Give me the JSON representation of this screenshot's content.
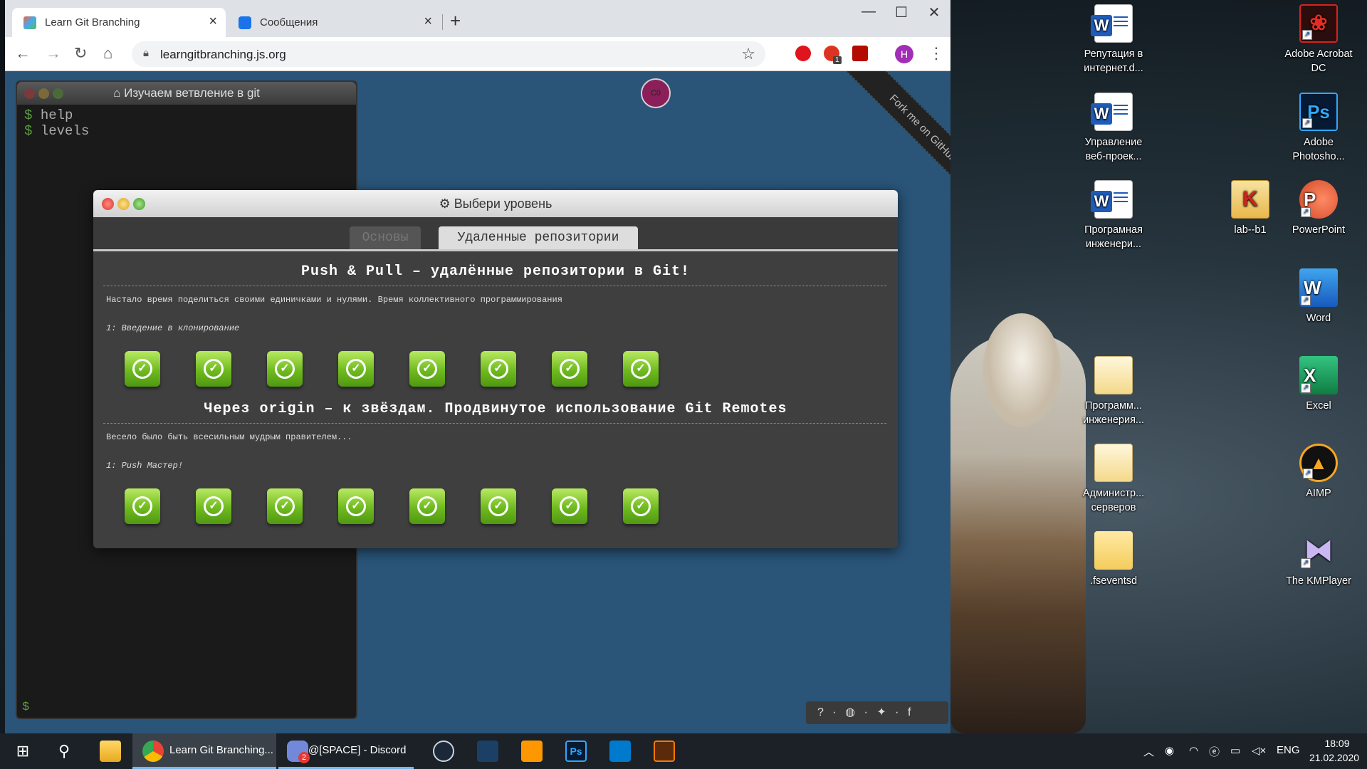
{
  "browser": {
    "tabs": [
      {
        "label": "Learn Git Branching",
        "active": true
      },
      {
        "label": "Сообщения",
        "active": false
      }
    ],
    "url": "learngitbranching.js.org",
    "profile_initial": "H",
    "extension_badge": "1"
  },
  "terminal": {
    "title": "Изучаем ветвление в git",
    "lines": [
      "help",
      "levels"
    ],
    "prompt": "$"
  },
  "commit_node": "C0",
  "fork_ribbon": "Fork me on GitHub",
  "modal": {
    "title": "Выбери уровень",
    "tabs": [
      "Основы",
      "Удаленные репозитории"
    ],
    "active_tab": "Удаленные репозитории",
    "sections": [
      {
        "title": "Push & Pull – удалённые репозитории в Git!",
        "description": "Настало время поделиться своими единичками и нулями. Время коллективного программирования",
        "subtitle": "1: Введение в клонирование",
        "levels_completed": 8
      },
      {
        "title": "Через origin – к звёздам. Продвинутое использование Git Remotes",
        "description": "Весело было быть всесильным мудрым правителем...",
        "subtitle": "1: Push Мастер!",
        "levels_completed": 8
      }
    ]
  },
  "desktop_icons": [
    {
      "label": "Репутация в интернет.d...",
      "type": "word-doc"
    },
    {
      "label": "Управление веб-проек...",
      "type": "word-doc"
    },
    {
      "label": "Програмная инженери...",
      "type": "word-doc"
    },
    {
      "label": "Программ... инженерия...",
      "type": "folder-doc"
    },
    {
      "label": "Администр... серверов",
      "type": "folder-doc"
    },
    {
      "label": ".fseventsd",
      "type": "folder"
    },
    {
      "label": "lab--b1",
      "type": "archive"
    },
    {
      "label": "Adobe Acrobat DC",
      "type": "acrobat"
    },
    {
      "label": "Adobe Photosho...",
      "type": "photoshop"
    },
    {
      "label": "PowerPoint",
      "type": "powerpoint"
    },
    {
      "label": "Word",
      "type": "word"
    },
    {
      "label": "Excel",
      "type": "excel"
    },
    {
      "label": "AIMP",
      "type": "aimp"
    },
    {
      "label": "The KMPlayer",
      "type": "kmplayer"
    }
  ],
  "taskbar": {
    "items": [
      {
        "label": "Learn Git Branching...",
        "icon": "chrome-icon"
      },
      {
        "label": "@[SPACE] - Discord",
        "icon": "discord-icon",
        "badge": "2"
      }
    ],
    "language": "ENG",
    "time": "18:09",
    "date": "21.02.2020"
  },
  "colors": {
    "page_bg": "#2a5478",
    "level_done": "#6fba1f",
    "commit_node": "#8b1f5a"
  }
}
